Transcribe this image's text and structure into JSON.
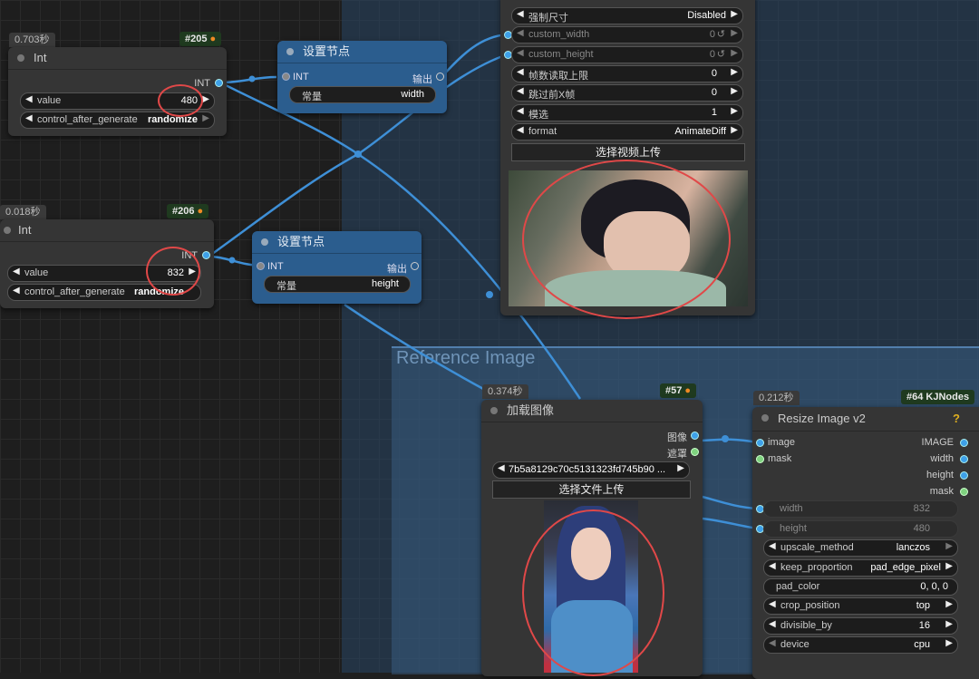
{
  "node205": {
    "time": "0.703秒",
    "id": "#205",
    "title": "Int",
    "out": "INT",
    "w_value_label": "value",
    "w_value": "480",
    "w_ctrl_label": "control_after_generate",
    "w_ctrl": "randomize"
  },
  "node206": {
    "time": "0.018秒",
    "id": "#206",
    "title": "Int",
    "out": "INT",
    "w_value_label": "value",
    "w_value": "832",
    "w_ctrl_label": "control_after_generate",
    "w_ctrl": "randomize"
  },
  "setnode1": {
    "title": "设置节点",
    "in": "INT",
    "out": "输出",
    "w_label": "常量",
    "w_value": "width"
  },
  "setnode2": {
    "title": "设置节点",
    "in": "INT",
    "out": "输出",
    "w_label": "常量",
    "w_value": "height"
  },
  "video": {
    "widgets": [
      {
        "label": "强制尺寸",
        "value": "Disabled"
      },
      {
        "label": "custom_width",
        "value": "0"
      },
      {
        "label": "custom_height",
        "value": "0"
      },
      {
        "label": "帧数读取上限",
        "value": "0"
      },
      {
        "label": "跳过前X帧",
        "value": "0"
      },
      {
        "label": "模选",
        "value": "1"
      },
      {
        "label": "format",
        "value": "AnimateDiff"
      }
    ],
    "upload": "选择视频上传"
  },
  "group": {
    "title": "Reference Image"
  },
  "node57": {
    "time": "0.374秒",
    "id": "#57",
    "title": "加载图像",
    "out_image": "图像",
    "out_mask": "遮罩",
    "file": "7b5a8129c70c5131323fd745b90 ...",
    "upload": "选择文件上传"
  },
  "node64": {
    "time": "0.212秒",
    "id": "#64 KJNodes",
    "title": "Resize Image v2",
    "help": "?",
    "in_image": "image",
    "in_mask": "mask",
    "out_image": "IMAGE",
    "out_width": "width",
    "out_height": "height",
    "out_mask": "mask",
    "widgets": [
      {
        "label": "width",
        "value": "832"
      },
      {
        "label": "height",
        "value": "480"
      },
      {
        "label": "upscale_method",
        "value": "lanczos"
      },
      {
        "label": "keep_proportion",
        "value": "pad_edge_pixel"
      },
      {
        "label": "pad_color",
        "value": "0, 0, 0"
      },
      {
        "label": "crop_position",
        "value": "top"
      },
      {
        "label": "divisible_by",
        "value": "16"
      },
      {
        "label": "device",
        "value": "cpu"
      }
    ]
  },
  "colors": {
    "accent": "#3ea0e8",
    "highlight": "#e04848",
    "node_blue": "#2b5d8e"
  }
}
